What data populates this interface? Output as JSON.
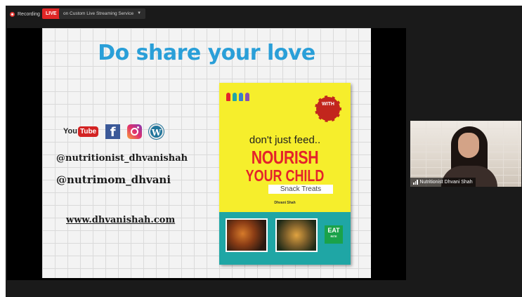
{
  "topbar": {
    "recording_label": "Recording",
    "live_label": "LIVE",
    "stream_label": "on Custom Live Streaming Service"
  },
  "slide": {
    "title": "Do share your love",
    "social": {
      "youtube_you": "You",
      "youtube_tube": "Tube",
      "facebook_glyph": "f",
      "wordpress_glyph": "W"
    },
    "handle_1": "@nutritionist_dhvanishah",
    "handle_2": "@nutrimom_dhvani",
    "website": "www.dhvanishah.com",
    "book": {
      "tagline": "don't just feed..",
      "title_line1": "NOURISH",
      "title_line2": "YOUR CHILD",
      "subtitle": "Snack Treats",
      "author": "Dhvani Shah",
      "badge_text": "WITH",
      "logo_line1": "EAT",
      "logo_line2": "RITE"
    }
  },
  "participant": {
    "name": "Nutritionist Dhvani Shah"
  },
  "colors": {
    "title_blue": "#2a9fd8",
    "live_red": "#e02626",
    "book_yellow": "#f6ee2c",
    "book_red": "#e4232b"
  }
}
